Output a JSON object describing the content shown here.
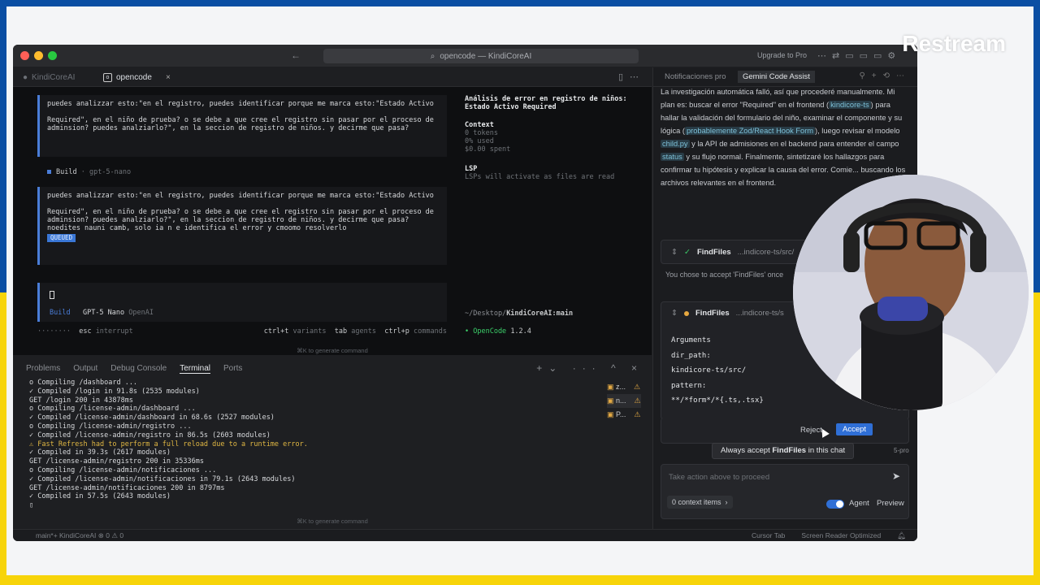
{
  "overlay": {
    "watermark": "Restream"
  },
  "window": {
    "back_icon": "←",
    "search_icon": "⌕",
    "title": "opencode — KindiCoreAI",
    "upgrade": "Upgrade to Pro",
    "tabs": [
      {
        "label": "KindiCoreAI"
      },
      {
        "label": "opencode",
        "icon": "o",
        "close": "×"
      }
    ]
  },
  "editor": {
    "msg1": {
      "line1": "puedes analizzar esto:\"en el registro, puedes identificar porque me marca esto:\"Estado Activo",
      "line2": "Required\", en el niño de prueba? o se debe a que cree el registro sin pasar por el proceso de adminsion? puedes analziarlo?\", en la seccion de registro de niños. y decirme que pasa?"
    },
    "build1": {
      "label": "Build",
      "model": "· gpt-5-nano"
    },
    "msg2": {
      "line1": "puedes analizzar esto:\"en el registro, puedes identificar porque me marca esto:\"Estado Activo",
      "line2": "Required\", en el niño de prueba? o se debe a que cree el registro sin pasar por el proceso de adminsion? puedes analziarlo?\", en la seccion de registro de niños. y decirme que pasa? noedites nauni camb, solo ia n e identifica el error y cmoomo resolverlo",
      "badge": "QUEUED"
    },
    "input": {
      "mode": "Build",
      "model": "GPT-5 Nano",
      "provider": "OpenAI"
    },
    "status": {
      "dots": "········",
      "esc": "esc",
      "interrupt": "interrupt",
      "variants_key": "ctrl+t",
      "variants": "variants",
      "agents_key": "tab",
      "agents": "agents",
      "commands_key": "ctrl+p",
      "commands": "commands"
    },
    "side": {
      "title": "Análisis de error en registro de niños: Estado Activo Required",
      "context_label": "Context",
      "tokens": "0 tokens",
      "used": "0% used",
      "spent": "$0.00 spent",
      "lsp_label": "LSP",
      "lsp_text": "LSPs will activate as files are read",
      "path": "~/Desktop/",
      "path_bold": "KindiCoreAI:main",
      "app": "• OpenCode",
      "version": "1.2.4"
    },
    "gen_cmd": "⌘K to generate command"
  },
  "panel": {
    "tabs": [
      "Problems",
      "Output",
      "Debug Console",
      "Terminal",
      "Ports"
    ],
    "active_tab": "Terminal",
    "controls": "+⌄ ··· ^ ×",
    "terminal_lines": [
      {
        "t": "o Compiling /dashboard ...",
        "c": "ok"
      },
      {
        "t": "✓ Compiled /login in 91.8s (2535 modules)",
        "c": "ok"
      },
      {
        "t": "GET /login 200 in 43878ms",
        "c": "ok"
      },
      {
        "t": "o Compiling /license-admin/dashboard ...",
        "c": "ok"
      },
      {
        "t": "✓ Compiled /license-admin/dashboard in 68.6s (2527 modules)",
        "c": "ok"
      },
      {
        "t": "o Compiling /license-admin/registro ...",
        "c": "ok"
      },
      {
        "t": "✓ Compiled /license-admin/registro in 86.5s (2603 modules)",
        "c": "ok"
      },
      {
        "t": "⚠ Fast Refresh had to perform a full reload due to a runtime error.",
        "c": "warn"
      },
      {
        "t": "✓ Compiled in 39.3s (2617 modules)",
        "c": "ok"
      },
      {
        "t": "GET /license-admin/registro 200 in 35336ms",
        "c": "ok"
      },
      {
        "t": "o Compiling /license-admin/notificaciones ...",
        "c": "ok"
      },
      {
        "t": "✓ Compiled /license-admin/notificaciones in 79.1s (2643 modules)",
        "c": "ok"
      },
      {
        "t": "GET /license-admin/notificaciones 200 in 8797ms",
        "c": "ok"
      },
      {
        "t": "✓ Compiled in 57.5s (2643 modules)",
        "c": "ok"
      },
      {
        "t": "▯",
        "c": "ok"
      }
    ],
    "term_list": [
      {
        "label": "z..."
      },
      {
        "label": "n..."
      },
      {
        "label": "P..."
      }
    ],
    "gen_cmd": "⌘K to generate command"
  },
  "statusbar": {
    "left": "main*+   KindiCoreAI   ⊗ 0 ⚠ 0",
    "cursor_tab": "Cursor Tab",
    "screen_reader": "Screen Reader Optimized"
  },
  "chat": {
    "tab1": "Notificaciones pro",
    "tab2": "Gemini Code Assist",
    "text": {
      "p1": "La investigación automática falló, así que procederé manualmente. Mi plan es: buscar el error \"Required\" en el frontend (",
      "h1": "kindicore-ts",
      "p2": ") para hallar la validación del formulario del niño, examinar el componente y su lógica (",
      "h2": "probablemente Zod/React Hook Form",
      "p3": "), luego revisar el modelo ",
      "h3": "child.py",
      "p4": " y la API de admisiones en el backend para entender el campo ",
      "h4": "status",
      "p5": " y su flujo normal. Finalmente, sintetizaré los hallazgos para confirmar tu hipótesis y explicar la causa del error. Comie... buscando los archivos relevantes en el frontend."
    },
    "card1": {
      "name": "FindFiles",
      "path": "...indicore-ts/src/"
    },
    "chose": "You chose to accept 'FindFiles' once",
    "card2": {
      "name": "FindFiles",
      "path": "...indicore-ts/s",
      "args_label": "Arguments",
      "dir_key": "dir_path:",
      "dir_val": "kindicore-ts/src/",
      "pattern_key": "pattern:",
      "pattern_val": "**/*form*/*{.ts,.tsx}"
    },
    "reject": "Reject",
    "accept": "Accept",
    "tooltip_a": "Always accept ",
    "tooltip_b": "FindFiles",
    "tooltip_c": " in this chat",
    "model_frag": "5-pro",
    "input_placeholder": "Take action above to proceed",
    "context_items": "0 context items",
    "agent": "Agent",
    "preview": "Preview"
  }
}
